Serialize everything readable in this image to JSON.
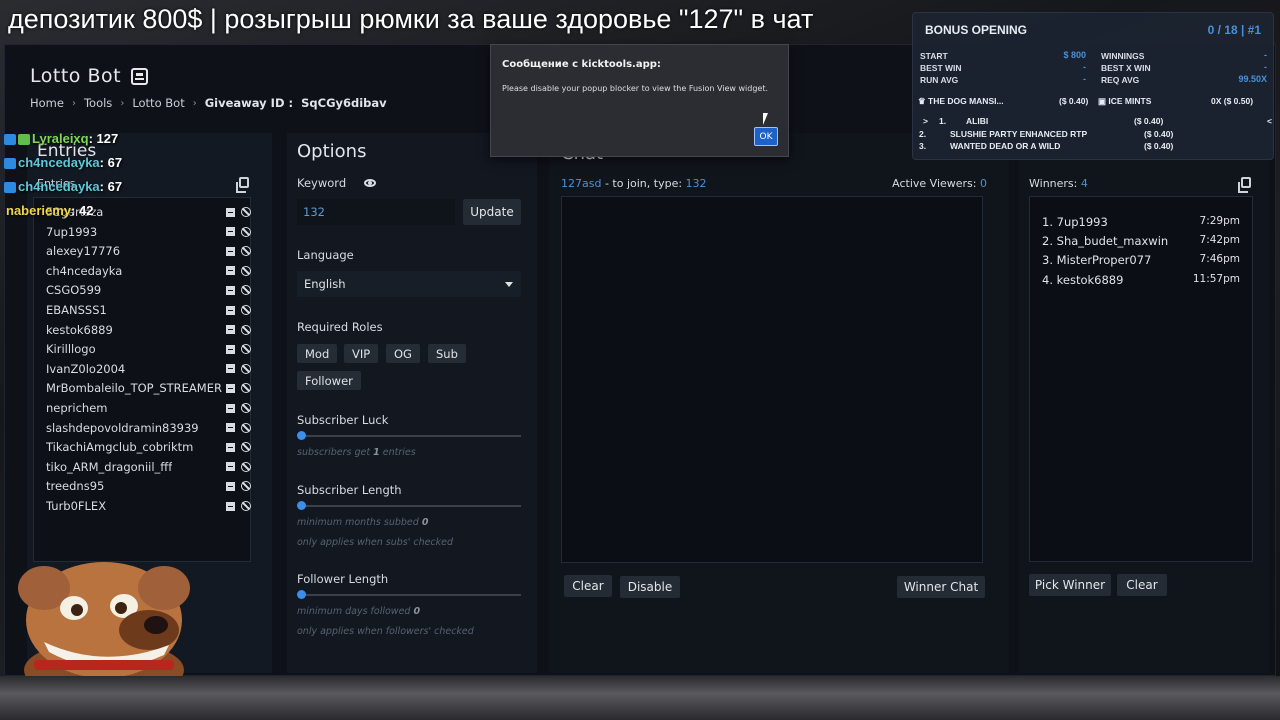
{
  "stream_title": "депозитик 800$ | розыгрыш рюмки за ваше здоровье \"127\" в чат",
  "app": {
    "title": "Lotto Bot",
    "breadcrumb": [
      "Home",
      "Tools",
      "Lotto Bot"
    ],
    "giveaway_label": "Giveaway ID :",
    "giveaway_id": "SqCGy6dibav"
  },
  "entries": {
    "heading": "Entries",
    "sub": "Entries",
    "items": [
      "52gertsza",
      "7up1993",
      "alexey17776",
      "ch4ncedayka",
      "CSGO599",
      "EBANSSS1",
      "kestok6889",
      "Kirilllogo",
      "IvanZ0lo2004",
      "MrBombaleilo_TOP_STREAMER",
      "neprichem",
      "slashdepovoldramin83939",
      "TikachiAmgclub_cobriktm",
      "tiko_ARM_dragoniil_fff",
      "treedns95",
      "Turb0FLEX"
    ]
  },
  "options": {
    "heading": "Options",
    "keyword_label": "Keyword",
    "keyword_value": "132",
    "update_label": "Update",
    "language_label": "Language",
    "language_value": "English",
    "roles_label": "Required Roles",
    "roles": [
      "Mod",
      "VIP",
      "OG",
      "Sub",
      "Follower"
    ],
    "sub_luck_label": "Subscriber Luck",
    "sub_luck_hint_pre": "subscribers get",
    "sub_luck_hint_val": "1",
    "sub_luck_hint_post": "entries",
    "sub_length_label": "Subscriber Length",
    "sub_length_hint_pre": "minimum months subbed",
    "sub_length_hint_val": "0",
    "sub_length_note": "only applies when subs' checked",
    "follower_length_label": "Follower Length",
    "follower_length_hint_pre": "minimum days followed",
    "follower_length_hint_val": "0",
    "follower_length_note": "only applies when followers' checked"
  },
  "chat": {
    "heading": "Chat",
    "join_keyword": "127asd",
    "join_mid": "- to join, type:",
    "join_value": "132",
    "active_viewers_label": "Active Viewers:",
    "active_viewers_value": "0",
    "clear_label": "Clear",
    "disable_label": "Disable",
    "winner_chat_label": "Winner Chat"
  },
  "winners": {
    "title": "Winners:",
    "count": "4",
    "items": [
      {
        "rank": "1.",
        "name": "7up1993",
        "time": "7:29pm"
      },
      {
        "rank": "2.",
        "name": "Sha_budet_maxwin",
        "time": "7:42pm"
      },
      {
        "rank": "3.",
        "name": "MisterProper077",
        "time": "7:46pm"
      },
      {
        "rank": "4.",
        "name": "kestok6889",
        "time": "11:57pm"
      }
    ],
    "pick_label": "Pick Winner",
    "clear_label": "Clear"
  },
  "overlay_chat": [
    {
      "user": "Lyraleixq",
      "msg": ": 127",
      "color": "#7ed957"
    },
    {
      "user": "ch4ncedayka",
      "msg": ": 67",
      "color": "#5ec8d8"
    },
    {
      "user": "ch4ncedayka",
      "msg": ": 67",
      "color": "#5ec8d8"
    },
    {
      "user": "naberiemy",
      "msg": ": 42",
      "color": "#f0d64a"
    }
  ],
  "popup": {
    "title": "Сообщение с kicktools.app:",
    "message": "Please disable your popup blocker to view the Fusion View widget.",
    "ok_label": "OK"
  },
  "bonus": {
    "title": "BONUS OPENING",
    "count": "0 / 18 | #1",
    "start_label": "START",
    "start_value": "$ 800",
    "best_win_label": "BEST WIN",
    "best_win_value": "-",
    "run_avg_label": "RUN AVG",
    "run_avg_value": "-",
    "winnings_label": "WINNINGS",
    "winnings_value": "-",
    "best_x_label": "BEST X WIN",
    "best_x_value": "-",
    "req_avg_label": "REQ AVG",
    "req_avg_value": "99.50X",
    "featured_left": "THE DOG MANSI...",
    "featured_left_val": "($ 0.40)",
    "featured_right": "ICE MINTS",
    "featured_right_val": "0X ($ 0.50)",
    "list": [
      {
        "n": "1.",
        "name": "ALIBI",
        "val": "($ 0.40)"
      },
      {
        "n": "2.",
        "name": "SLUSHIE PARTY ENHANCED RTP",
        "val": "($ 0.40)"
      },
      {
        "n": "3.",
        "name": "WANTED DEAD OR A WILD",
        "val": "($ 0.40)"
      }
    ]
  },
  "colors": {
    "accent_blue": "#4a90d9",
    "panel_bg": "#10151c",
    "button_bg": "#252b35"
  }
}
